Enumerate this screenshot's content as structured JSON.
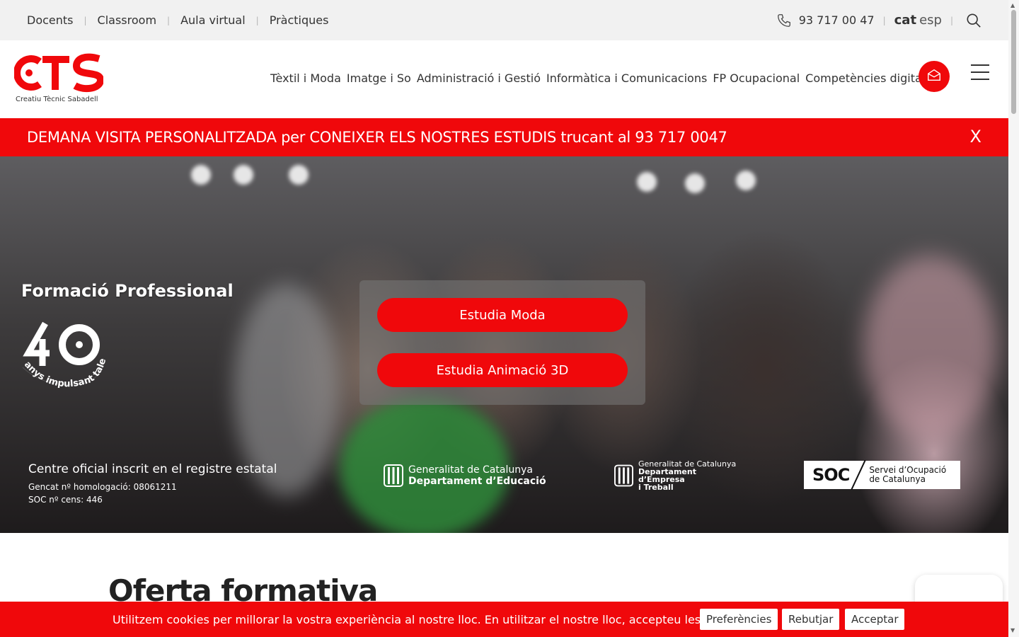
{
  "topbar": {
    "links": [
      "Docents",
      "Classroom",
      "Aula virtual",
      "Pràctiques"
    ],
    "phone": "93 717 00 47",
    "lang_active": "cat",
    "lang_other": "esp"
  },
  "header": {
    "logo_text": "CTS",
    "logo_tagline": "Creatiu Tècnic Sabadell",
    "nav": [
      "Tèxtil i Moda",
      "Imatge i So",
      "Administració i Gestió",
      "Informàtica i Comunicacions",
      "FP Ocupacional",
      "Competències digitals"
    ]
  },
  "banner": {
    "text": "DEMANA VISITA PERSONALITZADA per CONEIXER ELS NOSTRES ESTUDIS trucant al 93 717 0047",
    "close": "X"
  },
  "hero": {
    "title": "Formació Professional",
    "badge_number": "40",
    "badge_text": "anys impulsant talent",
    "cta1": "Estudia Moda",
    "cta2": "Estudia Animació 3D",
    "official_title": "Centre oficial inscrit en el registre estatal",
    "official_line1": "Gencat nº homologació: 08061211",
    "official_line2": "SOC nº cens: 446",
    "gen_edu_l1": "Generalitat de Catalunya",
    "gen_edu_l2": "Departament d’Educació",
    "gen_emp_l1": "Generalitat de Catalunya",
    "gen_emp_l2": "Departament d’Empresa",
    "gen_emp_l3": "i Treball",
    "soc_big": "SOC",
    "soc_l1": "Servei d’Ocupació",
    "soc_l2": "de Catalunya"
  },
  "content": {
    "title": "Oferta formativa"
  },
  "cookie": {
    "text": "Utilitzem cookies per millorar la vostra experiència al nostre lloc. En utilitzar el nostre lloc, accepteu les cookies.",
    "btn_prefs": "Preferències",
    "btn_reject": "Rebutjar",
    "btn_accept": "Acceptar"
  },
  "colors": {
    "brand_red": "#f0080b",
    "topbar_bg": "#f1f1f1"
  },
  "icons": [
    "phone-icon",
    "search-icon",
    "mail-icon",
    "menu-icon",
    "close-icon"
  ]
}
